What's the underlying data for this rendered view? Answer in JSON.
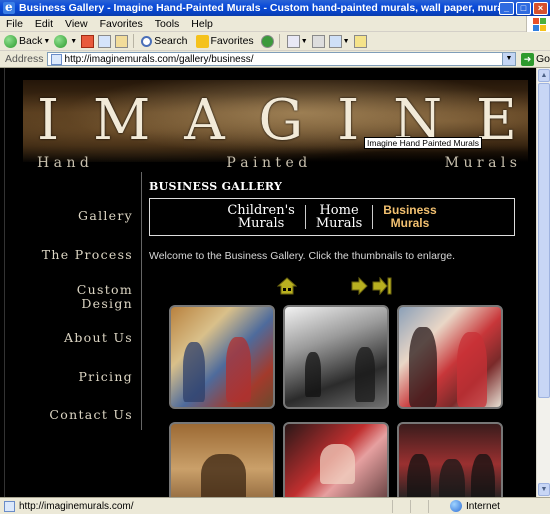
{
  "window": {
    "title": "Business Gallery - Imagine Hand-Painted Murals - Custom hand-painted murals, wall paper, mural  - Microsoft Internet Explorer",
    "controls": [
      "_",
      "□",
      "×"
    ]
  },
  "menu": {
    "items": [
      "File",
      "Edit",
      "View",
      "Favorites",
      "Tools",
      "Help"
    ]
  },
  "toolbar": {
    "back_label": "Back",
    "search_label": "Search",
    "favorites_label": "Favorites"
  },
  "address": {
    "label": "Address",
    "url": "http://imaginemurals.com/gallery/business/",
    "go_label": "Go"
  },
  "banner": {
    "title_letters": [
      "I",
      "M",
      "A",
      "G",
      "I",
      "N",
      "E"
    ],
    "tooltip": "Imagine Hand Painted Murals",
    "subtitle_words": [
      "H a n d",
      "P a i n t e d",
      "M u r a l s"
    ]
  },
  "sidebar": {
    "items": [
      {
        "label": "Gallery"
      },
      {
        "label": "The Process"
      },
      {
        "label": "Custom"
      },
      {
        "label": "Design"
      },
      {
        "label": "About Us"
      },
      {
        "label": "Pricing"
      },
      {
        "label": "Contact Us"
      }
    ]
  },
  "gallery": {
    "heading": "BUSINESS GALLERY",
    "tabs": [
      {
        "line1": "Children's",
        "line2": "Murals"
      },
      {
        "line1": "Home",
        "line2": "Murals"
      },
      {
        "line1": "Business",
        "line2": "Murals"
      }
    ],
    "welcome": "Welcome to the Business Gallery. Click the thumbnails to enlarge.",
    "nav_icons": [
      "home-icon",
      "next-arrow-icon",
      "last-arrow-icon"
    ]
  },
  "status": {
    "url": "http://imaginemurals.com/",
    "zone": "Internet"
  },
  "colors": {
    "title_bar": "#0b4bd8",
    "page_background": "#000000",
    "active_tab": "#f2c070",
    "nav_icon": "#b8b020"
  }
}
